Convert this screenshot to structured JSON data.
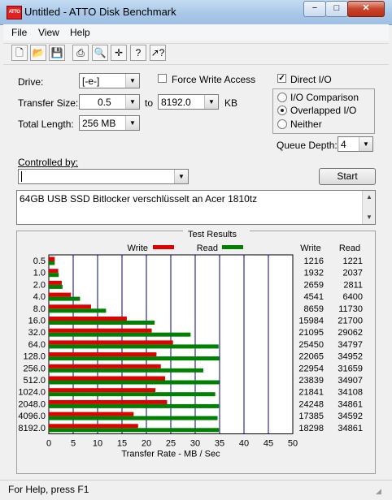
{
  "window": {
    "title": "Untitled - ATTO Disk Benchmark",
    "icon_text": "ATTO",
    "min_label": "−",
    "max_label": "□",
    "close_label": "✕"
  },
  "menu": {
    "file": "File",
    "view": "View",
    "help": "Help"
  },
  "toolbar": [
    {
      "name": "new-icon",
      "glyph": "🗋"
    },
    {
      "name": "open-icon",
      "glyph": "📂"
    },
    {
      "name": "save-icon",
      "glyph": "💾"
    },
    {
      "name": "print-icon",
      "glyph": "⎙"
    },
    {
      "name": "print-preview-icon",
      "glyph": "🔍"
    },
    {
      "name": "move-icon",
      "glyph": "✛"
    },
    {
      "name": "help-icon",
      "glyph": "?"
    },
    {
      "name": "context-help-icon",
      "glyph": "↗?"
    }
  ],
  "form": {
    "drive_label": "Drive:",
    "drive_value": "[-e-]",
    "force_write_label": "Force Write Access",
    "direct_io_label": "Direct I/O",
    "direct_io_checked": true,
    "transfer_size_label": "Transfer Size:",
    "transfer_from": "0.5",
    "to_label": "to",
    "transfer_to": "8192.0",
    "unit": "KB",
    "total_length_label": "Total Length:",
    "total_length_value": "256 MB",
    "io_comparison": "I/O Comparison",
    "overlapped_io": "Overlapped I/O",
    "neither": "Neither",
    "queue_depth_label": "Queue Depth:",
    "queue_depth_value": "4",
    "controlled_by_label": "Controlled by:",
    "controlled_by_value": "",
    "start_label": "Start",
    "description": "64GB USB SSD Bitlocker verschlüsselt an Acer 1810tz"
  },
  "results": {
    "title": "Test Results",
    "write_legend": "Write",
    "read_legend": "Read",
    "write_header": "Write",
    "read_header": "Read",
    "write_color": "#e00000",
    "read_color": "#008000"
  },
  "chart_data": {
    "type": "bar",
    "orientation": "horizontal",
    "categories": [
      "0.5",
      "1.0",
      "2.0",
      "4.0",
      "8.0",
      "16.0",
      "32.0",
      "64.0",
      "128.0",
      "256.0",
      "512.0",
      "1024.0",
      "2048.0",
      "4096.0",
      "8192.0"
    ],
    "series": [
      {
        "name": "Write",
        "values": [
          1216,
          1932,
          2659,
          4541,
          8659,
          15984,
          21095,
          25450,
          22065,
          22954,
          23839,
          21841,
          24248,
          17385,
          18298
        ]
      },
      {
        "name": "Read",
        "values": [
          1221,
          2037,
          2811,
          6400,
          11730,
          21700,
          29062,
          34797,
          34952,
          31659,
          34907,
          34108,
          34861,
          34592,
          34861
        ]
      }
    ],
    "xlabel": "Transfer Rate - MB / Sec",
    "xticks": [
      "0",
      "5",
      "10",
      "15",
      "20",
      "25",
      "30",
      "35",
      "40",
      "45",
      "50"
    ],
    "xlim": [
      0,
      50
    ],
    "grid": true,
    "legend": "top"
  },
  "status": {
    "text": "For Help, press F1"
  }
}
